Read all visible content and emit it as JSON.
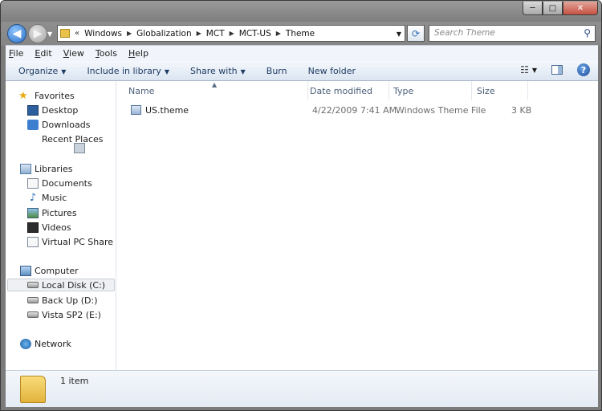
{
  "window": {
    "caption": {
      "minimize": "─",
      "maximize": "□",
      "close": "✕"
    }
  },
  "nav": {
    "back_glyph": "◀",
    "forward_glyph": "▶",
    "recent_glyph": "▼"
  },
  "address": {
    "chevron": "«",
    "crumbs": [
      "Windows",
      "Globalization",
      "MCT",
      "MCT-US",
      "Theme"
    ],
    "separator": "▶",
    "dropdown": "▼",
    "refresh_glyph": "⟳"
  },
  "search": {
    "placeholder": "Search Theme",
    "icon_glyph": "⚲"
  },
  "menu": {
    "items": [
      {
        "first": "F",
        "rest": "ile"
      },
      {
        "first": "E",
        "rest": "dit"
      },
      {
        "first": "V",
        "rest": "iew"
      },
      {
        "first": "T",
        "rest": "ools"
      },
      {
        "first": "H",
        "rest": "elp"
      }
    ]
  },
  "toolbar": {
    "organize": "Organize",
    "include_in_library": "Include in library",
    "share_with": "Share with",
    "burn": "Burn",
    "new_folder": "New folder",
    "dropdown_glyph": "▼",
    "views_glyph": "☷",
    "help_glyph": "?"
  },
  "sidebar": {
    "favorites": "Favorites",
    "desktop": "Desktop",
    "downloads": "Downloads",
    "recent_places": "Recent Places",
    "libraries": "Libraries",
    "documents": "Documents",
    "music": "Music",
    "pictures": "Pictures",
    "videos": "Videos",
    "virtual_pc_share": "Virtual PC Share",
    "computer": "Computer",
    "local_disk": "Local Disk (C:)",
    "back_up": "Back Up (D:)",
    "vista_sp2": "Vista SP2 (E:)",
    "network": "Network",
    "star_glyph": "★",
    "music_glyph": "♪"
  },
  "columns": {
    "name": "Name",
    "date_modified": "Date modified",
    "type": "Type",
    "size": "Size",
    "sort_glyph": "▲"
  },
  "files": [
    {
      "name": "US.theme",
      "date": "4/22/2009 7:41 AM",
      "type": "Windows Theme File",
      "size": "3 KB"
    }
  ],
  "details": {
    "item_count": "1 item"
  }
}
